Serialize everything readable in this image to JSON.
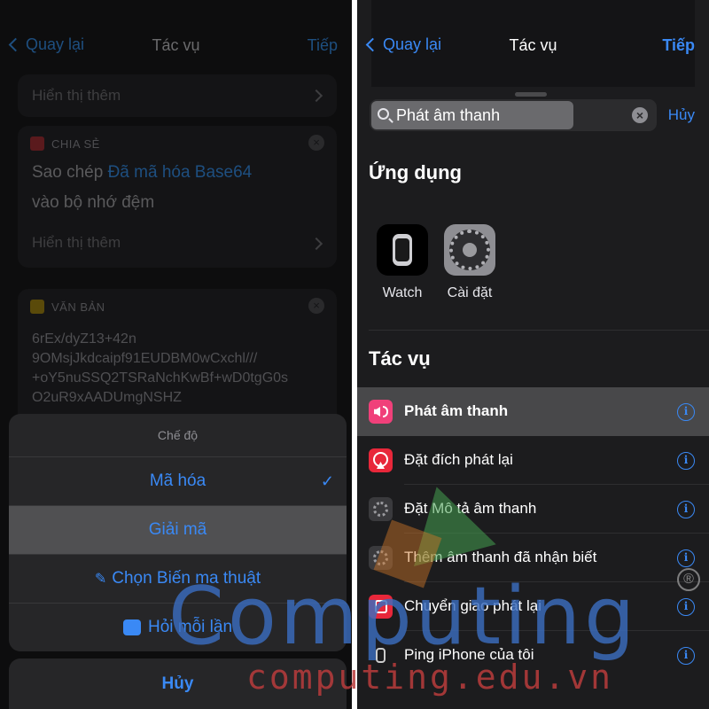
{
  "left": {
    "nav": {
      "back": "Quay lại",
      "title": "Tác vụ",
      "next": "Tiếp"
    },
    "show_more": "Hiển thị thêm",
    "share_card": {
      "tag": "CHIA SẺ",
      "line1_prefix": "Sao chép",
      "line1_var": "Đã mã hóa Base64",
      "line2": "vào bộ nhớ đệm",
      "show_more": "Hiển thị thêm"
    },
    "text_card": {
      "tag": "VĂN BẢN",
      "lines": [
        "6rEx/dyZ13+42n",
        "9OMsjJkdcaipf91EUDBM0wCxchl///",
        "+oY5nuSSQ2TSRaNchKwBf+wD0tgG0s",
        "O2uR9xAADUmgNSHZ"
      ]
    },
    "sheet": {
      "title": "Chế độ",
      "options": [
        "Mã hóa",
        "Giải mã",
        "Chọn Biến ma thuật",
        "Hỏi mỗi lần"
      ],
      "checked_index": 0,
      "cancel": "Hủy"
    }
  },
  "right": {
    "nav": {
      "back": "Quay lại",
      "title": "Tác vụ",
      "next": "Tiếp"
    },
    "search": {
      "value": "Phát âm thanh",
      "cancel": "Hủy"
    },
    "apps_title": "Ứng dụng",
    "apps": [
      {
        "label": "Watch",
        "icon": "watch-app-icon"
      },
      {
        "label": "Cài đặt",
        "icon": "settings-app-icon"
      }
    ],
    "actions_title": "Tác vụ",
    "actions": [
      {
        "label": "Phát âm thanh",
        "icon": "speaker-icon",
        "color": "#f0407a"
      },
      {
        "label": "Đặt đích phát lại",
        "icon": "airplay-icon",
        "color": "#e8273a"
      },
      {
        "label": "Đặt Mô tả âm thanh",
        "icon": "gear-icon",
        "color": "#3a3a3d"
      },
      {
        "label": "Thêm âm thanh đã nhận biết",
        "icon": "gear-icon",
        "color": "#3a3a3d"
      },
      {
        "label": "Chuyển giao phát lại",
        "icon": "handoff-icon",
        "color": "#e8273a"
      },
      {
        "label": "Ping iPhone của tôi",
        "icon": "watch-icon",
        "color": "#1c1c1e"
      }
    ]
  },
  "watermark": {
    "brand": "Computing",
    "url": "computing.edu.vn",
    "mark": "®"
  }
}
